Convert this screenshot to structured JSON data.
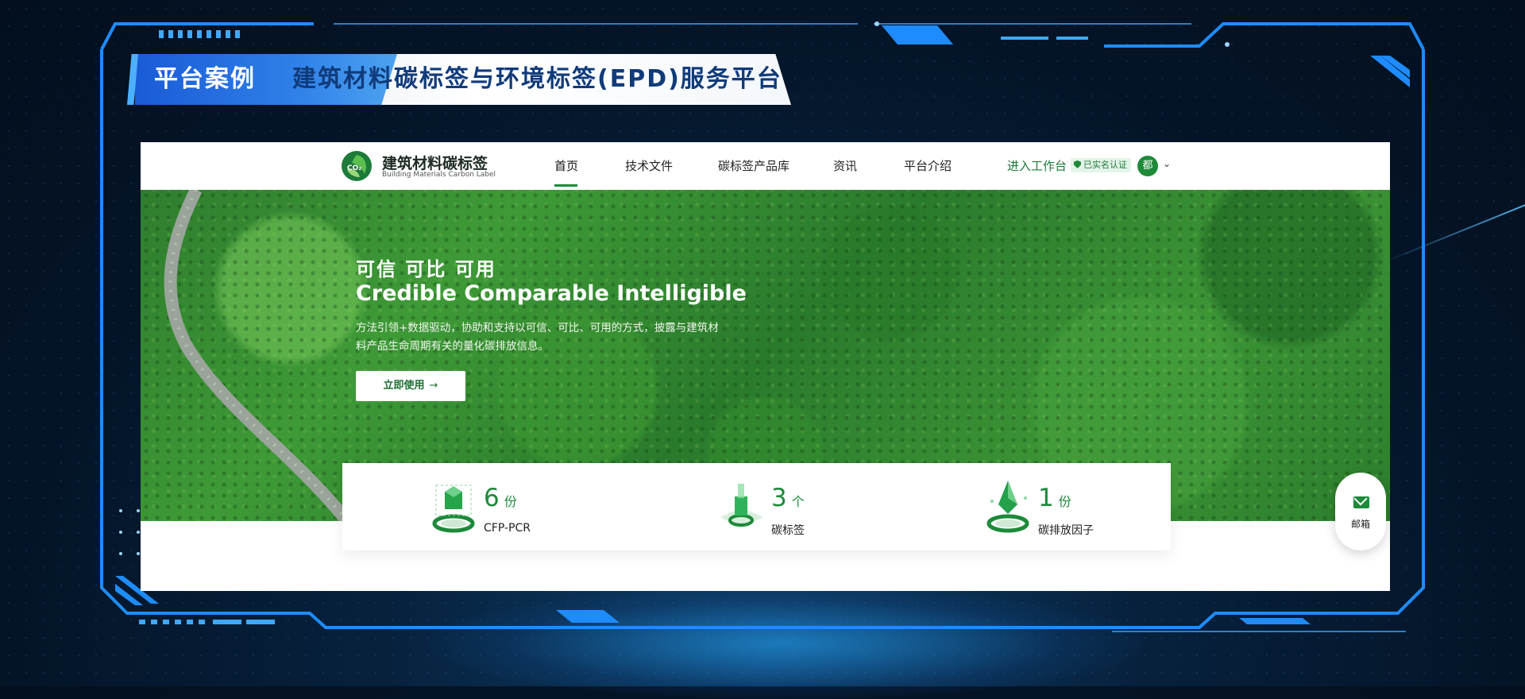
{
  "banner": {
    "tag": "平台案例",
    "title": "建筑材料碳标签与环境标签(EPD)服务平台"
  },
  "site": {
    "logo_title": "建筑材料碳标签",
    "logo_subtitle": "Building Materials Carbon Label",
    "logo_mark_text": "CO₂",
    "nav": [
      {
        "label": "首页",
        "active": true
      },
      {
        "label": "技术文件"
      },
      {
        "label": "碳标签产品库"
      },
      {
        "label": "资讯"
      },
      {
        "label": "平台介绍"
      }
    ],
    "workbench": "进入工作台",
    "verified": "已实名认证",
    "avatar": "都",
    "chevron": "⌄"
  },
  "hero": {
    "heading": "可信  可比  可用",
    "heading_en": "Credible Comparable Intelligible",
    "description": "方法引领+数据驱动，协助和支持以可信、可比、可用的方式，披露与建筑材料产品生命周期有关的量化碳排放信息。",
    "button": "立即使用",
    "button_arrow": "→"
  },
  "stats": [
    {
      "value": "6",
      "unit": "份",
      "label": "CFP-PCR"
    },
    {
      "value": "3",
      "unit": "个",
      "label": "碳标签"
    },
    {
      "value": "1",
      "unit": "份",
      "label": "碳排放因子"
    }
  ],
  "mailbox": {
    "label": "邮箱"
  },
  "colors": {
    "brand_green": "#1d8a3a",
    "frame_blue": "#1e8cff",
    "banner_blue": "#1a5bd6"
  }
}
